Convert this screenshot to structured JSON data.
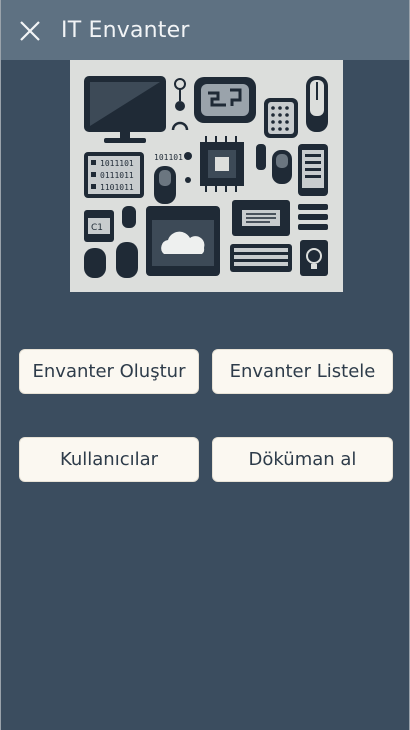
{
  "window": {
    "title": "IT Envanter",
    "close_icon": "close-icon"
  },
  "hero": {
    "icon": "it-hardware-illustration",
    "lettering": [
      "1011101",
      "0111011",
      "1101011",
      "101101",
      "C1"
    ]
  },
  "menu": {
    "create_label": "Envanter Oluştur",
    "list_label": "Envanter Listele",
    "users_label": "Kullanıcılar",
    "docs_label": "Döküman al"
  },
  "colors": {
    "background": "#3b4d5f",
    "titlebar": "#5e7182",
    "button": "#fbf8f1",
    "button_text": "#2e3c4a"
  }
}
